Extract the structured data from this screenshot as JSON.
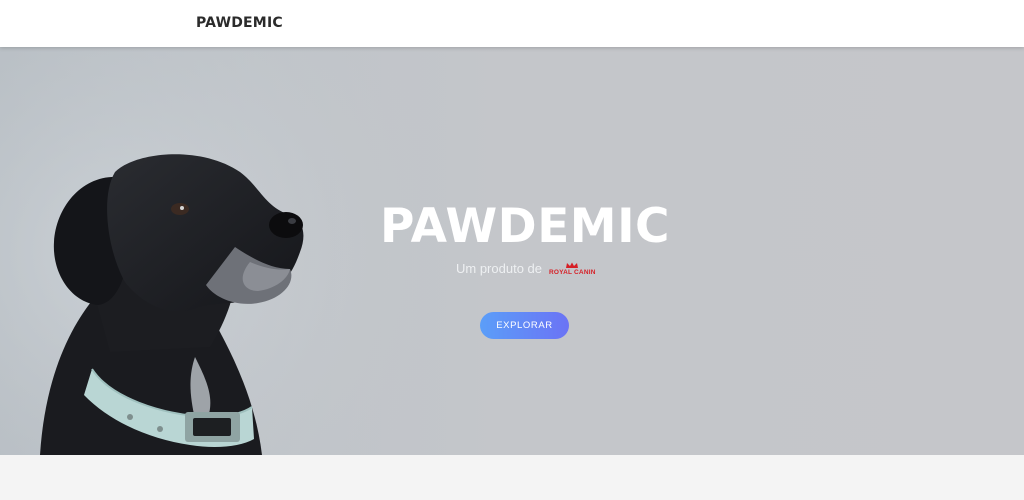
{
  "navbar": {
    "brand": "PAWDEMIC"
  },
  "hero": {
    "title": "PAWDEMIC",
    "subtitle_text": "Um produto de",
    "sponsor_logo": {
      "text": "ROYAL CANIN",
      "icon": "crown-icon",
      "color": "#d61f26"
    },
    "cta_label": "EXPLORAR",
    "cta_gradient": [
      "#5b9ef8",
      "#6b73f5"
    ],
    "image": "black-dog-photo"
  },
  "colors": {
    "hero_background": "#c4c6ca",
    "page_background": "#f4f4f4",
    "nav_background": "#ffffff"
  }
}
